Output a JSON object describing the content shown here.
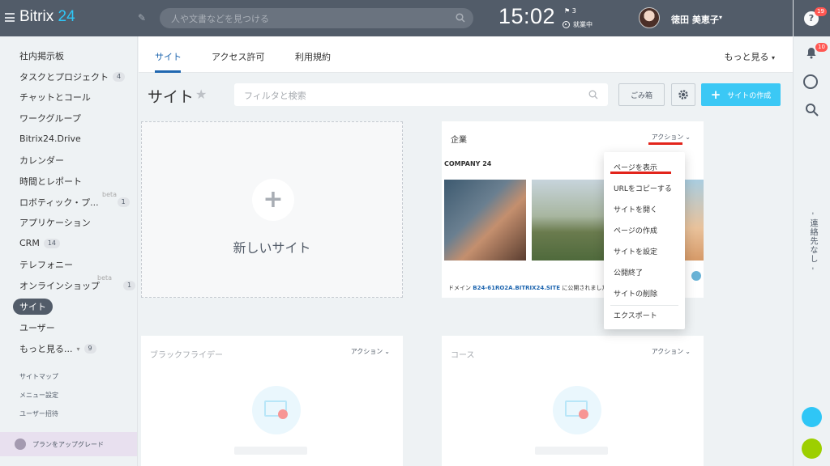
{
  "header": {
    "logo_text": "Bitrix",
    "logo_num": "24",
    "search_placeholder": "人や文書などを見つける",
    "clock": "15:02",
    "flag_count": "3",
    "work_status": "就業中",
    "user_name": "徳田 美恵子"
  },
  "right_panel": {
    "help_badge": "19",
    "bell_badge": "10",
    "vertical_text": "- 連絡先なし -"
  },
  "sidebar": {
    "items": [
      {
        "label": "社内掲示板",
        "badge": ""
      },
      {
        "label": "タスクとプロジェクト",
        "badge": "4"
      },
      {
        "label": "チャットとコール",
        "badge": ""
      },
      {
        "label": "ワークグループ",
        "badge": ""
      },
      {
        "label": "Bitrix24.Drive",
        "badge": ""
      },
      {
        "label": "カレンダー",
        "badge": ""
      },
      {
        "label": "時間とレポート",
        "badge": ""
      },
      {
        "label": "ロボティック・プ...",
        "badge": "1",
        "beta": "beta"
      },
      {
        "label": "アプリケーション",
        "badge": ""
      },
      {
        "label": "CRM",
        "badge": "14"
      },
      {
        "label": "テレフォニー",
        "badge": ""
      },
      {
        "label": "オンラインショップ",
        "badge": "1",
        "beta": "beta"
      },
      {
        "label": "サイト",
        "badge": ""
      },
      {
        "label": "ユーザー",
        "badge": ""
      },
      {
        "label": "もっと見る...",
        "badge": "9"
      }
    ],
    "sitemap": "サイトマップ",
    "menu_settings": "メニュー設定",
    "invite_users": "ユーザー招待",
    "upgrade": "プランをアップグレード"
  },
  "tabs": {
    "items": [
      "サイト",
      "アクセス許可",
      "利用規約"
    ],
    "more": "もっと見る"
  },
  "toolbar": {
    "title": "サイト",
    "filter_placeholder": "フィルタと検索",
    "trash": "ごみ箱",
    "create": "サイトの作成"
  },
  "cards": {
    "new_site": "新しいサイト",
    "actions": "アクション",
    "card1": {
      "title": "企業",
      "brand": "COMPANY 24",
      "domain_prefix": "ドメイン",
      "domain": "B24-61RO2A.BITRIX24.SITE",
      "domain_suffix": "に公開されました"
    },
    "card2": {
      "title": "ブラックフライデー"
    },
    "card3": {
      "title": "コース"
    }
  },
  "dropdown": {
    "items": [
      "ページを表示",
      "URLをコピーする",
      "サイトを開く",
      "ページの作成",
      "サイトを設定",
      "公開終了",
      "サイトの削除",
      "エクスポート"
    ]
  }
}
